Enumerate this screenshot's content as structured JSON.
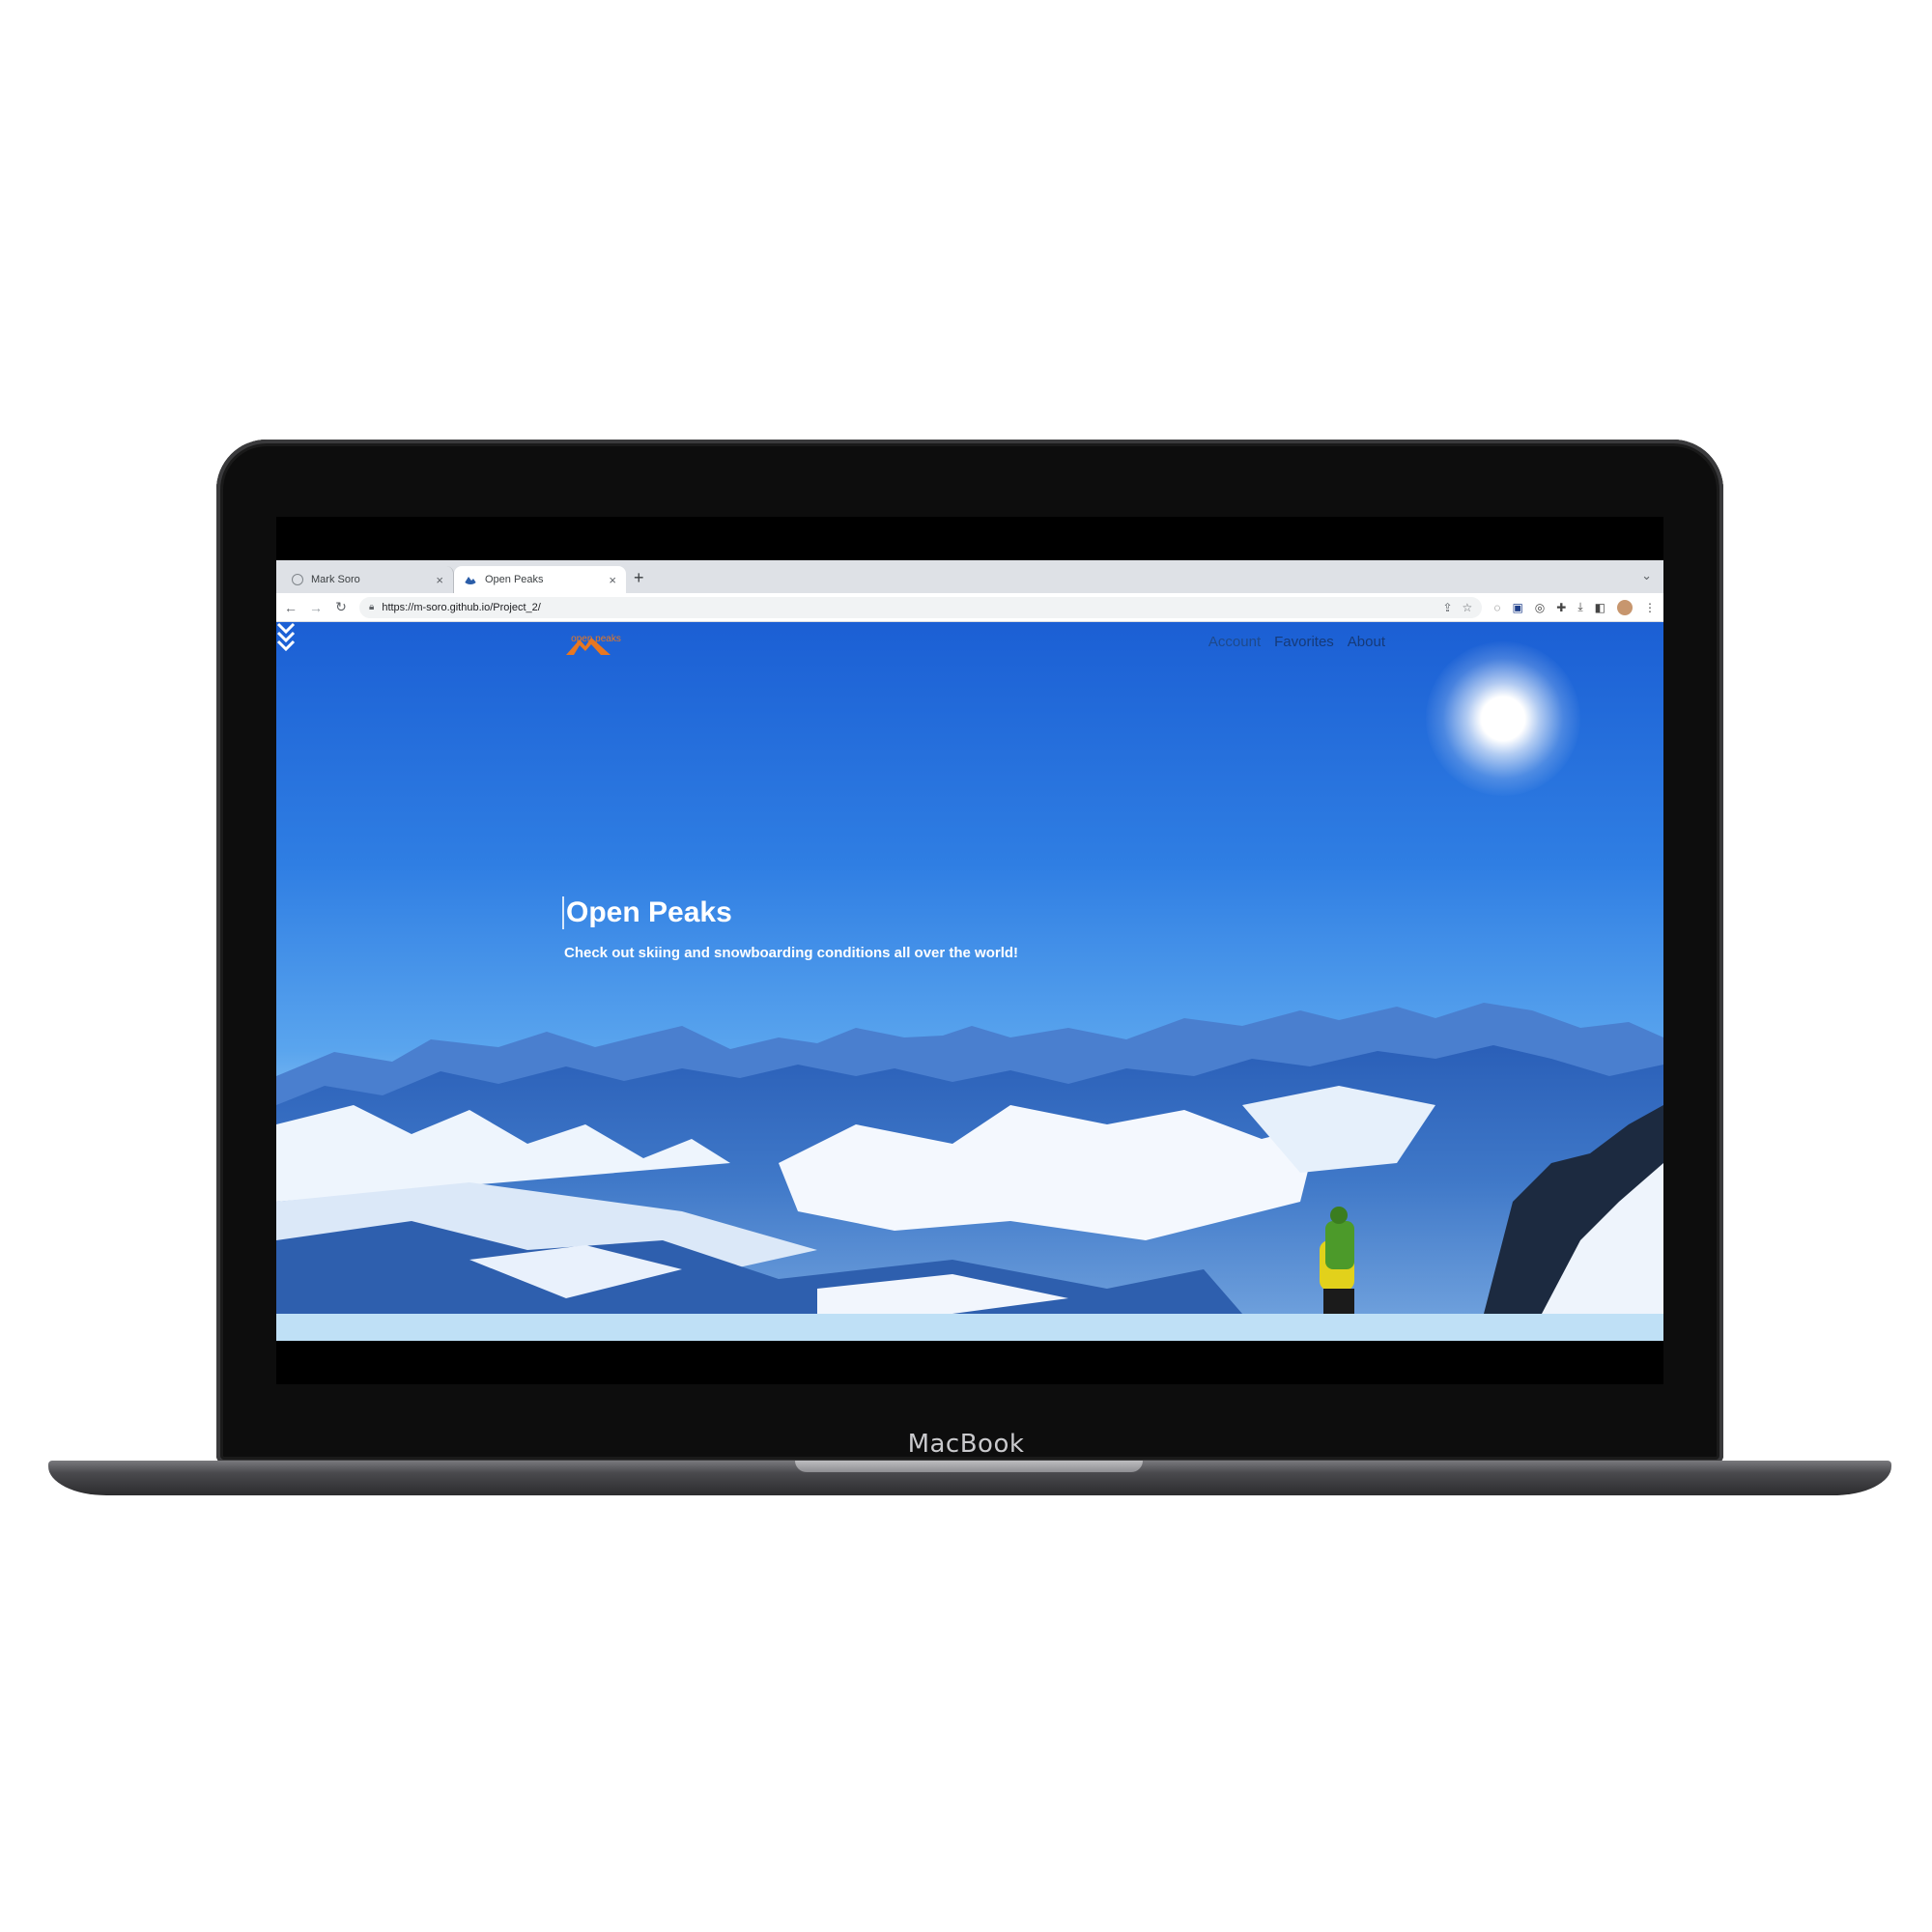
{
  "device": {
    "brand": "MacBook"
  },
  "browser": {
    "tabs": [
      {
        "title": "Mark Soro",
        "active": false,
        "close": "×"
      },
      {
        "title": "Open Peaks",
        "active": true,
        "close": "×"
      }
    ],
    "new_tab": "+",
    "url": "https://m-soro.github.io/Project_2/",
    "icons": [
      "back-icon",
      "forward-icon",
      "reload-icon",
      "lock-icon",
      "share-icon",
      "star-icon",
      "extensions-icon",
      "download-icon",
      "sidepanel-icon",
      "profile-avatar",
      "menu-icon"
    ]
  },
  "site": {
    "logo_text": "open peaks",
    "nav": [
      "Account",
      "Favorites",
      "About"
    ],
    "hero_title": "Open Peaks",
    "hero_subtitle": "Check out skiing and snowboarding conditions all over the world!",
    "accent_color": "#e87720"
  }
}
